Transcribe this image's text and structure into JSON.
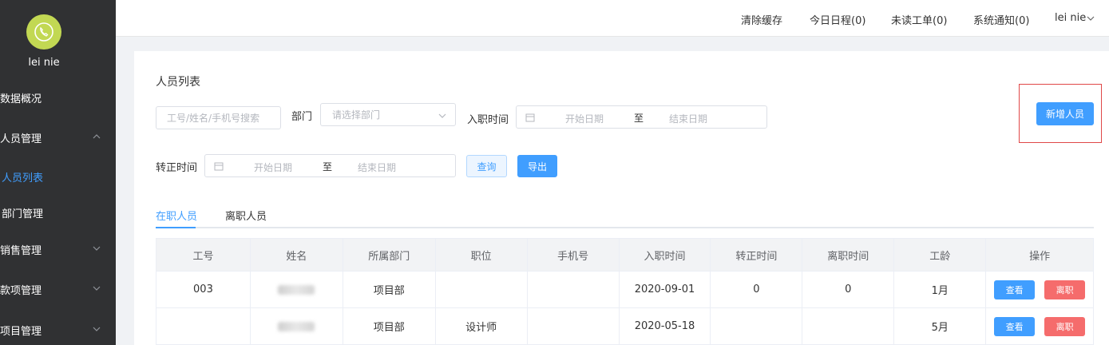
{
  "sidebar": {
    "username": "lei nie",
    "items": [
      {
        "label": "数据概况"
      },
      {
        "label": "人员管理"
      },
      {
        "label": "人员列表"
      },
      {
        "label": "部门管理"
      },
      {
        "label": "销售管理"
      },
      {
        "label": "款项管理"
      },
      {
        "label": "项目管理"
      }
    ]
  },
  "topbar": {
    "links": [
      "清除缓存",
      "今日日程(0)",
      "未读工单(0)",
      "系统通知(0)",
      "lei nie"
    ]
  },
  "page": {
    "title": "人员列表",
    "search_placeholder": "工号/姓名/手机号搜索",
    "dept_label": "部门",
    "dept_placeholder": "请选择部门",
    "join_label": "入职时间",
    "regular_label": "转正时间",
    "start_placeholder": "开始日期",
    "end_placeholder": "结束日期",
    "range_sep": "至",
    "query_btn": "查询",
    "export_btn": "导出",
    "add_btn": "新增人员"
  },
  "tabs": [
    "在职人员",
    "离职人员"
  ],
  "table": {
    "headers": [
      "工号",
      "姓名",
      "所属部门",
      "职位",
      "手机号",
      "入职时间",
      "转正时间",
      "离职时间",
      "工龄",
      "操作"
    ],
    "rows": [
      {
        "id": "003",
        "dept": "项目部",
        "position": "",
        "phone": "",
        "join": "2020-09-01",
        "regular": "0",
        "leave": "0",
        "tenure": "1月"
      },
      {
        "id": "",
        "dept": "项目部",
        "position": "设计师",
        "phone": "",
        "join": "2020-05-18",
        "regular": "",
        "leave": "",
        "tenure": "5月"
      }
    ],
    "view_btn": "查看",
    "leave_btn": "离职"
  },
  "colors": {
    "accent": "#409eff",
    "danger": "#f56c6c",
    "sidebar": "#303133",
    "avatar": "#c2d853"
  }
}
